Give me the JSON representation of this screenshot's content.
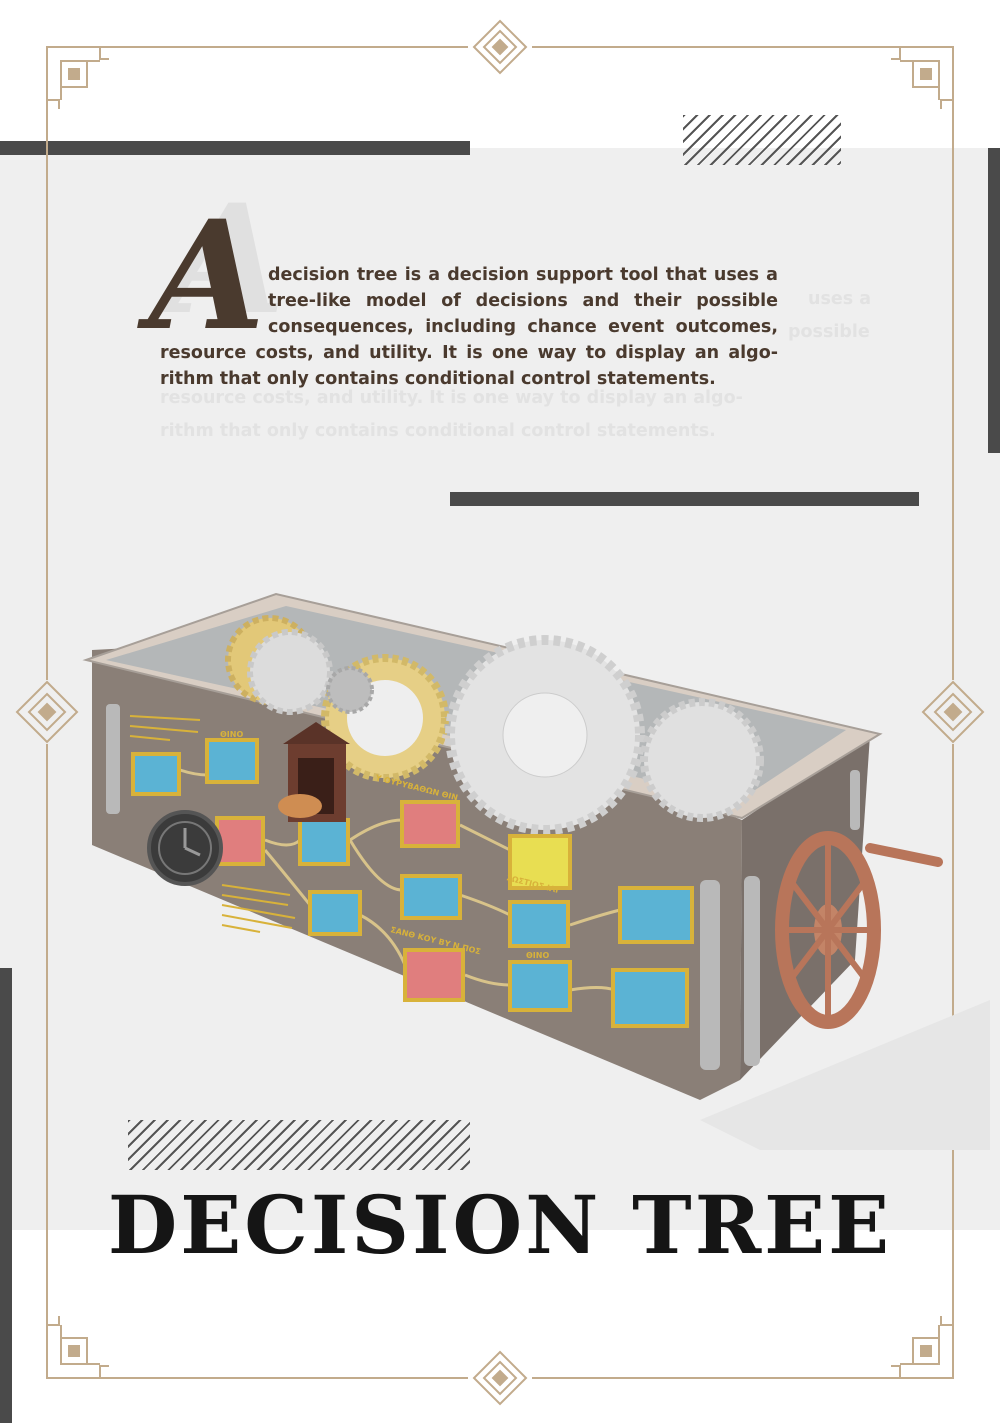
{
  "article": {
    "dropcap": "A",
    "lines": [
      "decision tree is a decision support tool that uses a",
      "tree-like model of decisions and their possible",
      "consequences, including chance event outcomes,",
      "resource costs, and utility. It is one way to display an algo-",
      "rithm that only contains conditional control statements."
    ],
    "shadow_lines": [
      "uses a",
      "possible"
    ]
  },
  "title": "DECISION TREE",
  "machine": {
    "node_colors": {
      "blue": "#5bb3d4",
      "red": "#e07e7e",
      "yellow": "#e8de52",
      "frame": "#d8b23a"
    },
    "engraved_labels": [
      "ΘΙΝΟ",
      "Υ ΟΥΡΥΒΑΘΩΝ ΘΙΝ",
      "ΣΩΣΤΙΟΣ ΙΛΙ",
      "ΣΑΝΘ ΚΟΥ ΒΥ Ν ΠΟΣ",
      "ΘΙΝΟ"
    ]
  },
  "colors": {
    "frame_gold": "#c2ab8c",
    "bars": "#4a4a4a",
    "text": "#4a3a2e",
    "panel": "#efefef"
  }
}
